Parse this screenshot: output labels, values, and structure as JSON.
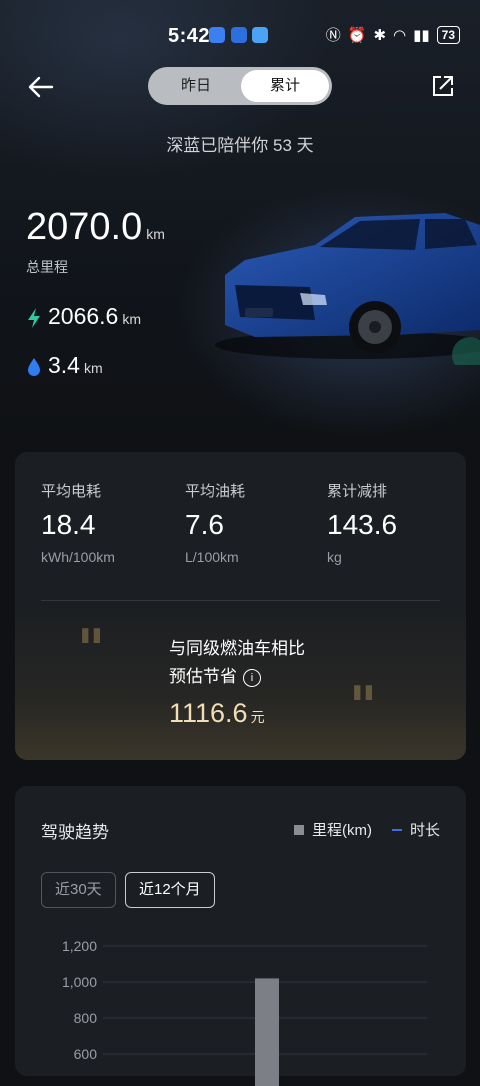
{
  "status_bar": {
    "time": "5:42",
    "battery": "73",
    "icons": [
      "app-icon-blue",
      "app-icon-blue-2",
      "weather-icon",
      "nfc-icon",
      "alarm-icon",
      "bluetooth-icon",
      "wifi-icon",
      "signal-icon"
    ]
  },
  "nav": {
    "tab_yesterday": "昨日",
    "tab_cumulative": "累计",
    "active_tab": "累计"
  },
  "companion_text": "深蓝已陪伴你 53 天",
  "mileage": {
    "total_value": "2070.0",
    "total_unit": "km",
    "total_label": "总里程",
    "electric_value": "2066.6",
    "electric_unit": "km",
    "fuel_value": "3.4",
    "fuel_unit": "km"
  },
  "stats": [
    {
      "label": "平均电耗",
      "value": "18.4",
      "unit": "kWh/100km"
    },
    {
      "label": "平均油耗",
      "value": "7.6",
      "unit": "L/100km"
    },
    {
      "label": "累计减排",
      "value": "143.6",
      "unit": "kg"
    }
  ],
  "savings": {
    "line1": "与同级燃油车相比",
    "line2": "预估节省",
    "value": "1116.6",
    "unit": "元"
  },
  "trend": {
    "title": "驾驶趋势",
    "legend_mileage": "里程(km)",
    "legend_duration": "时长",
    "range_30": "近30天",
    "range_12": "近12个月",
    "active_range": "近12个月"
  },
  "colors": {
    "accent_blue": "#3d6de0",
    "electric_green": "#2fc9a0",
    "fuel_blue": "#2f7df0",
    "savings_gold": "#f1deb6"
  },
  "chart_data": {
    "type": "bar",
    "yticks": [
      "1,200",
      "1,000",
      "800",
      "600"
    ],
    "ylim": [
      600,
      1200
    ],
    "series": [
      {
        "name": "里程(km)",
        "values": [
          1020
        ]
      }
    ],
    "grid": true
  }
}
